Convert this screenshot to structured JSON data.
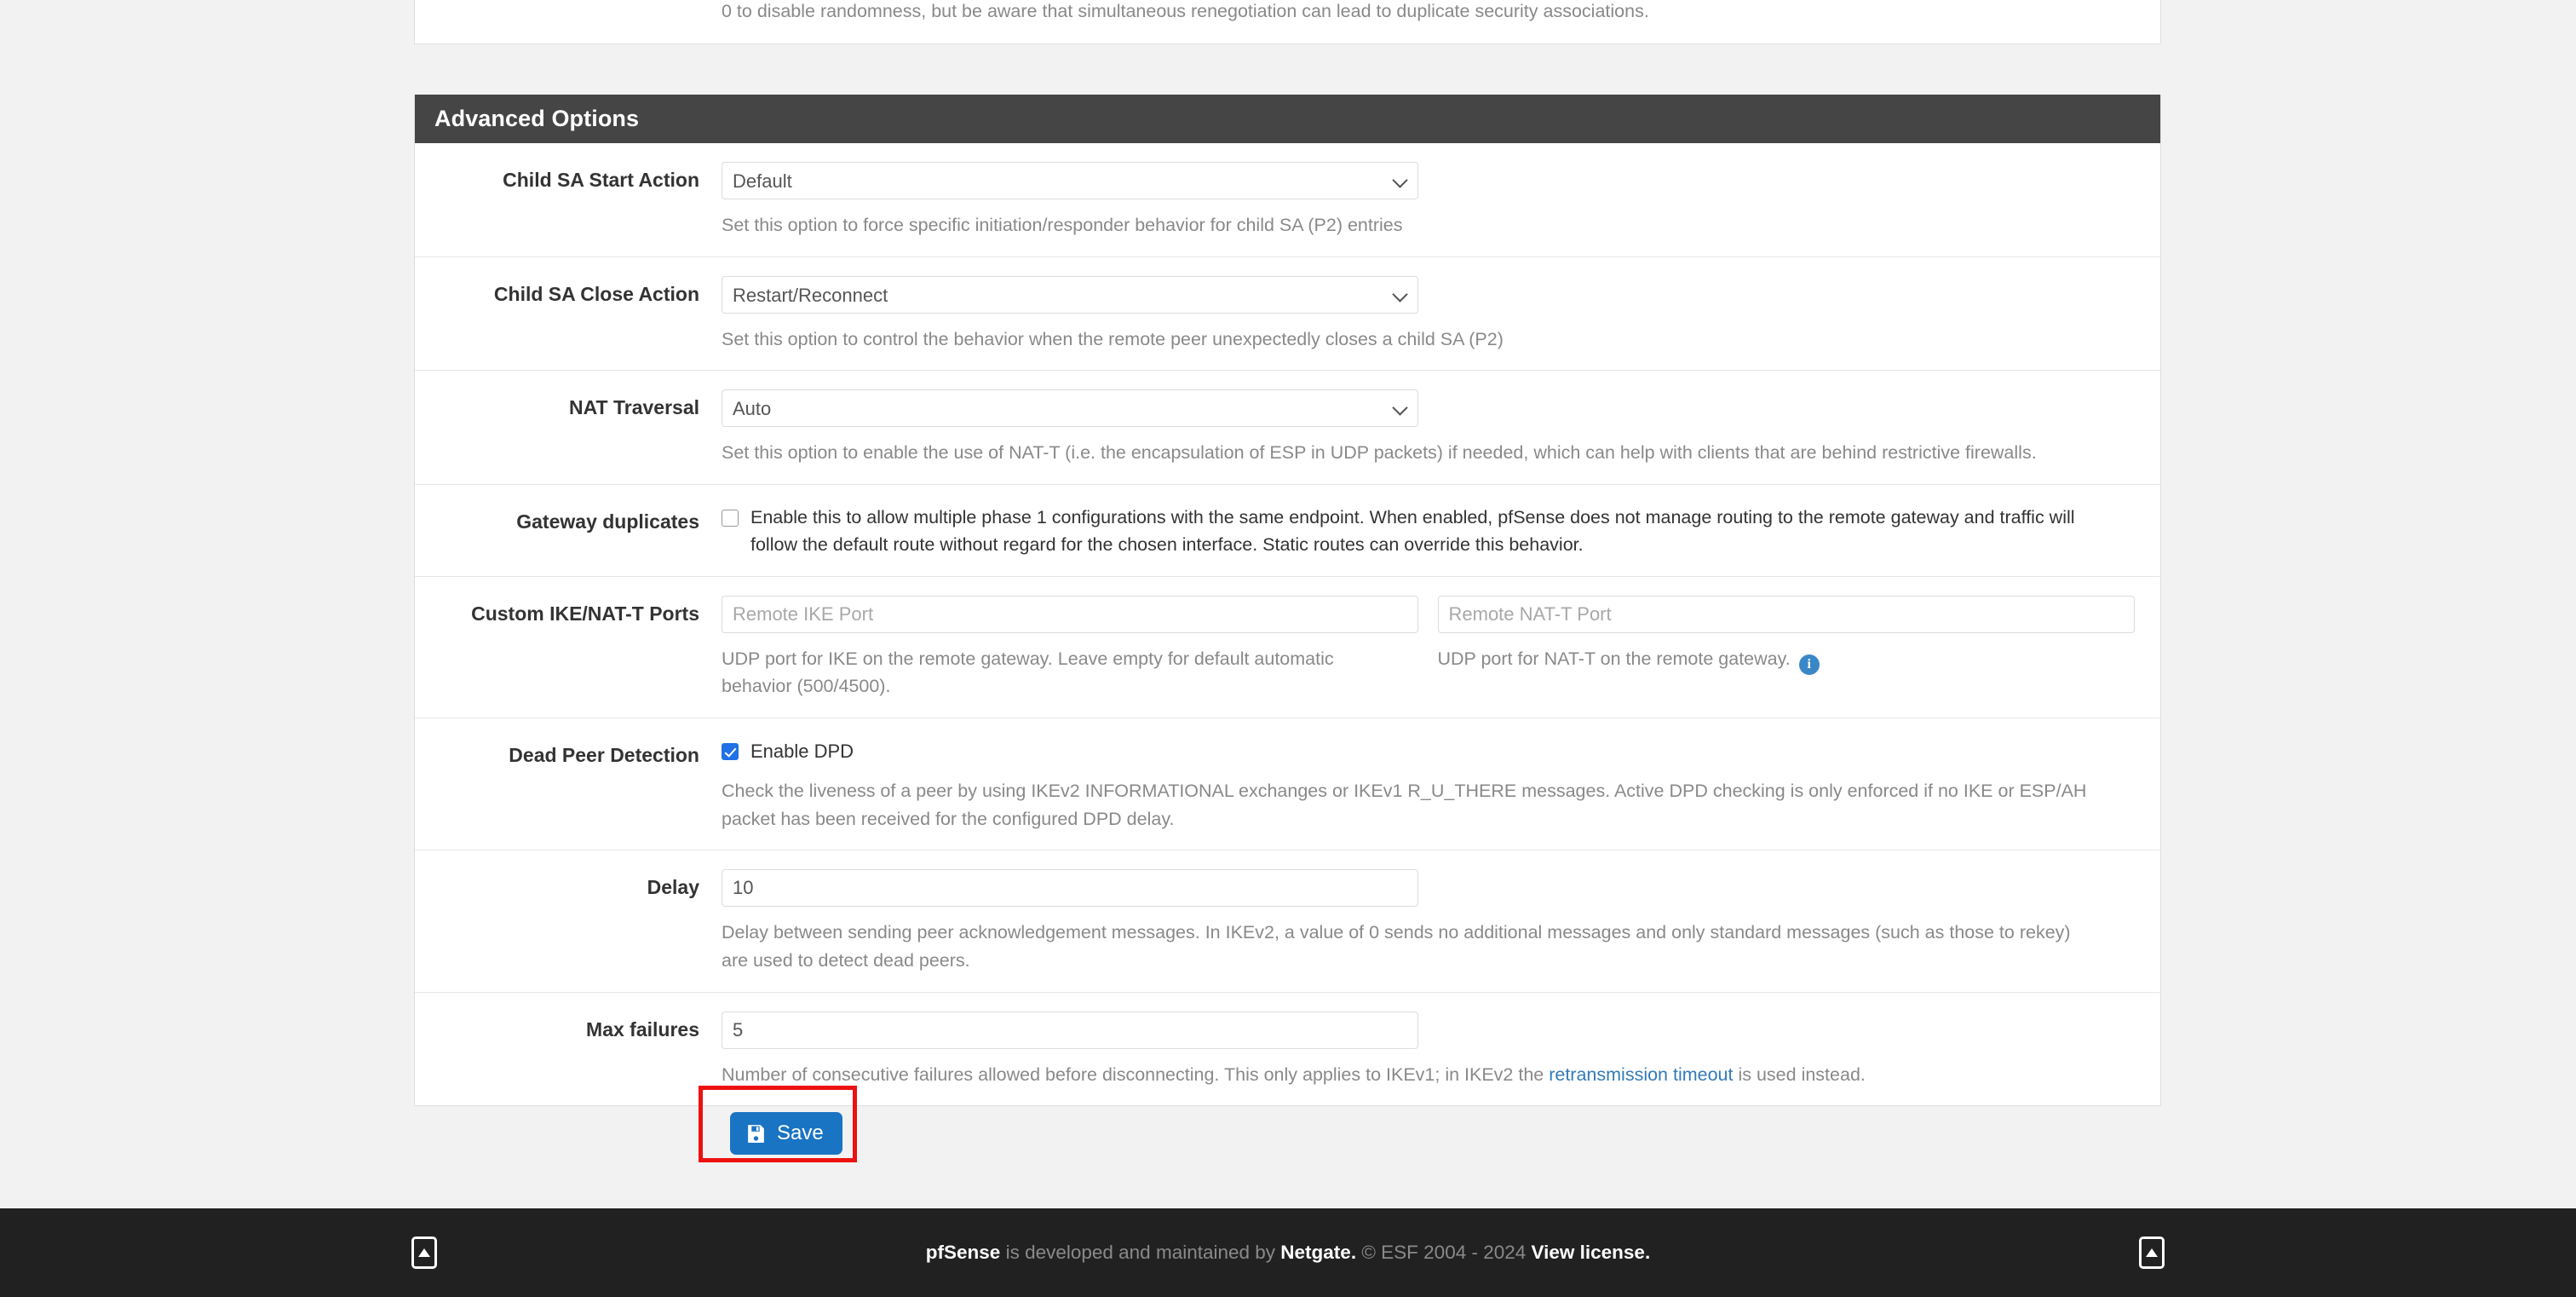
{
  "top_section": {
    "help_text": "A random value up to this amount will be subtracted from Rekey Time/Reauth Time to avoid simultaneous renegotiation. If left empty, defaults to 10% of Life Time. Enter 0 to disable randomness, but be aware that simultaneous renegotiation can lead to duplicate security associations."
  },
  "panel": {
    "heading": "Advanced Options",
    "rows": {
      "child_sa_start": {
        "label": "Child SA Start Action",
        "value": "Default",
        "help": "Set this option to force specific initiation/responder behavior for child SA (P2) entries"
      },
      "child_sa_close": {
        "label": "Child SA Close Action",
        "value": "Restart/Reconnect",
        "help": "Set this option to control the behavior when the remote peer unexpectedly closes a child SA (P2)"
      },
      "nat_traversal": {
        "label": "NAT Traversal",
        "value": "Auto",
        "help": "Set this option to enable the use of NAT-T (i.e. the encapsulation of ESP in UDP packets) if needed, which can help with clients that are behind restrictive firewalls."
      },
      "gateway_duplicates": {
        "label": "Gateway duplicates",
        "checkbox_label": "Enable this to allow multiple phase 1 configurations with the same endpoint. When enabled, pfSense does not manage routing to the remote gateway and traffic will follow the default route without regard for the chosen interface. Static routes can override this behavior.",
        "checked": false
      },
      "custom_ports": {
        "label": "Custom IKE/NAT-T Ports",
        "ike_placeholder": "Remote IKE Port",
        "ike_value": "",
        "ike_help": "UDP port for IKE on the remote gateway. Leave empty for default automatic behavior (500/4500).",
        "natt_placeholder": "Remote NAT-T Port",
        "natt_value": "",
        "natt_help": "UDP port for NAT-T on the remote gateway.",
        "info_glyph": "i"
      },
      "dpd": {
        "label": "Dead Peer Detection",
        "checkbox_label": "Enable DPD",
        "checked": true,
        "help": "Check the liveness of a peer by using IKEv2 INFORMATIONAL exchanges or IKEv1 R_U_THERE messages. Active DPD checking is only enforced if no IKE or ESP/AH packet has been received for the configured DPD delay."
      },
      "delay": {
        "label": "Delay",
        "value": "10",
        "help": "Delay between sending peer acknowledgement messages. In IKEv2, a value of 0 sends no additional messages and only standard messages (such as those to rekey) are used to detect dead peers."
      },
      "max_failures": {
        "label": "Max failures",
        "value": "5",
        "help_before": "Number of consecutive failures allowed before disconnecting. This only applies to IKEv1; in IKEv2 the ",
        "help_link": "retransmission timeout",
        "help_after": " is used instead."
      }
    }
  },
  "save": {
    "label": "Save",
    "icon": "save-floppy-icon",
    "highlight_color": "#ee1111",
    "button_color": "#1a74c4"
  },
  "footer": {
    "brand": "pfSense",
    "text_mid": " is developed and maintained by ",
    "company": "Netgate.",
    "copyright": " © ESF 2004 - 2024 ",
    "license_link": "View license.",
    "scroll_top_icon": "scroll-to-top-icon"
  }
}
